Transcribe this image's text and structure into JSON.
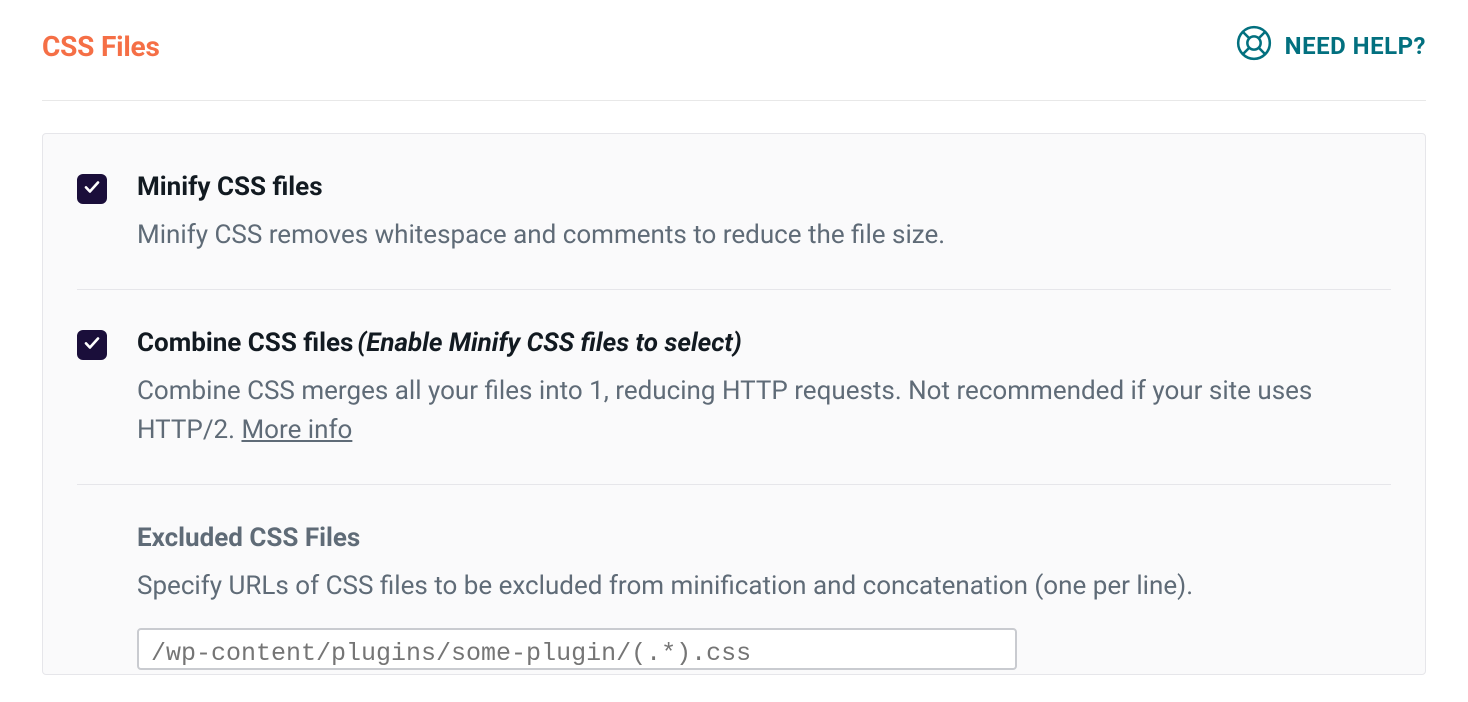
{
  "header": {
    "title": "CSS Files",
    "help_label": "NEED HELP?"
  },
  "options": {
    "minify": {
      "label": "Minify CSS files",
      "description": "Minify CSS removes whitespace and comments to reduce the file size."
    },
    "combine": {
      "label": "Combine CSS files",
      "note": "(Enable Minify CSS files to select)",
      "description": "Combine CSS merges all your files into 1, reducing HTTP requests. Not recommended if your site uses HTTP/2. ",
      "more_info": "More info"
    },
    "excluded": {
      "title": "Excluded CSS Files",
      "description": "Specify URLs of CSS files to be excluded from minification and concatenation (one per line).",
      "placeholder": "/wp-content/plugins/some-plugin/(.*).css"
    }
  }
}
